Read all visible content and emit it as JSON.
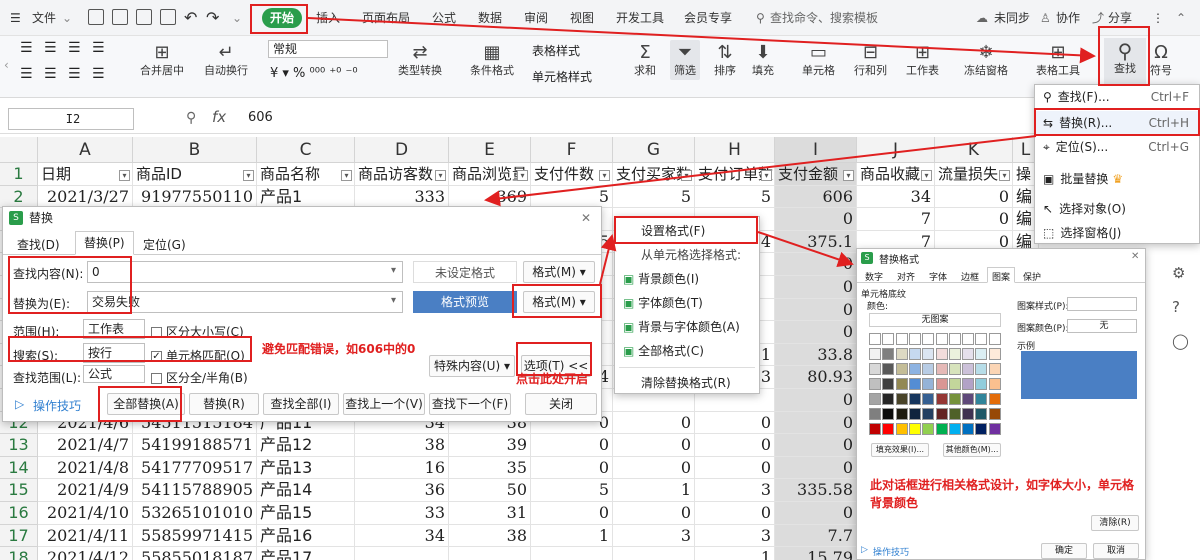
{
  "menubar": {
    "file": "文件",
    "tabs": [
      "开始",
      "插入",
      "页面布局",
      "公式",
      "数据",
      "审阅",
      "视图",
      "开发工具",
      "会员专享"
    ],
    "search": "查找命令、搜索模板",
    "sync": "未同步",
    "collab": "协作",
    "share": "分享"
  },
  "ribbon": {
    "merge": "合并居中",
    "wrap": "自动换行",
    "format_regular": "常规",
    "convert": "类型转换",
    "cond_format": "条件格式",
    "table_style": "表格样式",
    "cell_style": "单元格样式",
    "sum": "求和",
    "filter": "筛选",
    "sort": "排序",
    "fill": "填充",
    "cell": "单元格",
    "rowcol": "行和列",
    "sheet": "工作表",
    "freeze": "冻结窗格",
    "table_tools": "表格工具",
    "find": "查找",
    "symbol": "符号"
  },
  "formula": {
    "cell_ref": "I2",
    "fx": "fx",
    "value": "606"
  },
  "find_menu": {
    "items": [
      {
        "label": "查找(F)...",
        "shortcut": "Ctrl+F"
      },
      {
        "label": "替换(R)...",
        "shortcut": "Ctrl+H"
      },
      {
        "label": "定位(S)...",
        "shortcut": "Ctrl+G"
      },
      {
        "label": "批量替换",
        "shortcut": ""
      },
      {
        "label": "选择对象(O)",
        "shortcut": ""
      },
      {
        "label": "选择窗格(J)",
        "shortcut": ""
      }
    ]
  },
  "sheet": {
    "columns": [
      "A",
      "B",
      "C",
      "D",
      "E",
      "F",
      "G",
      "H",
      "I",
      "J",
      "K",
      "L"
    ],
    "headers": [
      "日期",
      "商品ID",
      "商品名称",
      "商品访客数",
      "商品浏览量",
      "支付件数",
      "支付买家数",
      "支付订单数",
      "支付金额",
      "商品收藏",
      "流量损失",
      "操"
    ],
    "rows": [
      {
        "n": "2",
        "cells": [
          "2021/3/27",
          "91977550110",
          "产品1",
          "333",
          "369",
          "5",
          "5",
          "5",
          "606",
          "34",
          "0",
          "编"
        ]
      },
      {
        "n": "3",
        "cells": [
          "",
          "",
          "",
          "",
          "",
          "",
          "",
          "",
          "0",
          "7",
          "0",
          "编"
        ]
      },
      {
        "n": "4",
        "cells": [
          "",
          "",
          "",
          "",
          "",
          "5",
          "",
          "4",
          "375.1",
          "7",
          "0",
          "编"
        ]
      },
      {
        "n": "5",
        "cells": [
          "",
          "",
          "",
          "",
          "",
          "",
          "",
          "",
          "0",
          "",
          "",
          ""
        ]
      },
      {
        "n": "6",
        "cells": [
          "",
          "",
          "",
          "",
          "",
          "",
          "",
          "",
          "0",
          "",
          "",
          ""
        ]
      },
      {
        "n": "7",
        "cells": [
          "",
          "",
          "",
          "",
          "",
          "",
          "",
          "",
          "0",
          "",
          "",
          ""
        ]
      },
      {
        "n": "8",
        "cells": [
          "",
          "",
          "",
          "",
          "",
          "",
          "",
          "",
          "0",
          "",
          "",
          ""
        ]
      },
      {
        "n": "9",
        "cells": [
          "",
          "",
          "",
          "",
          "",
          "",
          "",
          "1",
          "33.8",
          "",
          "",
          ""
        ]
      },
      {
        "n": "10",
        "cells": [
          "",
          "",
          "",
          "",
          "",
          "4",
          "1",
          "3",
          "80.93",
          "",
          "",
          ""
        ]
      },
      {
        "n": "11",
        "cells": [
          "",
          "",
          "",
          "",
          "",
          "",
          "",
          "",
          "0",
          "",
          "",
          ""
        ]
      },
      {
        "n": "12",
        "cells": [
          "2021/4/6",
          "54511515184",
          "产品11",
          "34",
          "38",
          "0",
          "0",
          "0",
          "0",
          "",
          "",
          ""
        ]
      },
      {
        "n": "13",
        "cells": [
          "2021/4/7",
          "54199188571",
          "产品12",
          "38",
          "39",
          "0",
          "0",
          "0",
          "0",
          "",
          "",
          ""
        ]
      },
      {
        "n": "14",
        "cells": [
          "2021/4/8",
          "54177709517",
          "产品13",
          "16",
          "35",
          "0",
          "0",
          "0",
          "0",
          "",
          "",
          ""
        ]
      },
      {
        "n": "15",
        "cells": [
          "2021/4/9",
          "54115788905",
          "产品14",
          "36",
          "50",
          "5",
          "1",
          "3",
          "335.58",
          "",
          "",
          ""
        ]
      },
      {
        "n": "16",
        "cells": [
          "2021/4/10",
          "53265101010",
          "产品15",
          "33",
          "31",
          "0",
          "0",
          "0",
          "0",
          "",
          "",
          ""
        ]
      },
      {
        "n": "17",
        "cells": [
          "2021/4/11",
          "55859971415",
          "产品16",
          "34",
          "38",
          "1",
          "3",
          "3",
          "7.7",
          "",
          "",
          ""
        ]
      },
      {
        "n": "18",
        "cells": [
          "2021/4/12",
          "55855018187",
          "产品17",
          "",
          "",
          "",
          "",
          "1",
          "15.79",
          "",
          "",
          ""
        ]
      }
    ]
  },
  "replace_dialog": {
    "title": "替换",
    "tabs": [
      "查找(D)",
      "替换(P)",
      "定位(G)"
    ],
    "find_label": "查找内容(N):",
    "find_value": "0",
    "replace_label": "替换为(E):",
    "replace_value": "交易失败",
    "no_format": "未设定格式",
    "format_btn": "格式(M)",
    "preview": "格式预览",
    "scope_label": "范围(H):",
    "scope_value": "工作表",
    "case": "区分大小写(C)",
    "search_label": "搜索(S):",
    "search_value": "按行",
    "cell_match": "单元格匹配(O)",
    "range_label": "查找范围(L):",
    "range_value": "公式",
    "width": "区分全/半角(B)",
    "special": "特殊内容(U)",
    "options": "选项(T) <<",
    "tips": "操作技巧",
    "replace_all": "全部替换(A)",
    "replace": "替换(R)",
    "find_all": "查找全部(I)",
    "find_prev": "查找上一个(V)",
    "find_next": "查找下一个(F)",
    "close": "关闭"
  },
  "format_menu": {
    "items": [
      "设置格式(F)",
      "从单元格选择格式:",
      "背景颜色(I)",
      "字体颜色(T)",
      "背景与字体颜色(A)",
      "全部格式(C)",
      "清除替换格式(R)"
    ]
  },
  "format_dialog": {
    "title": "替换格式",
    "tabs": [
      "数字",
      "对齐",
      "字体",
      "边框",
      "图案",
      "保护"
    ],
    "shading": "单元格底纹",
    "color_label": "颜色:",
    "no_color": "无图案",
    "pattern_style": "图案样式(P):",
    "pattern_color": "图案颜色(P):",
    "pattern_color_value": "无",
    "sample": "示例",
    "fill_effects": "填充效果(I)...",
    "more_colors": "其他颜色(M)...",
    "clear": "清除(R)",
    "tips": "操作技巧",
    "ok": "确定",
    "cancel": "取消",
    "sample_color": "#4a7fc4",
    "palette": [
      "#ffffff",
      "#ffffff",
      "#ffffff",
      "#ffffff",
      "#ffffff",
      "#ffffff",
      "#ffffff",
      "#ffffff",
      "#ffffff",
      "#ffffff",
      "#f2f2f2",
      "#7f7f7f",
      "#ddd9c3",
      "#c6d9f0",
      "#dbe5f1",
      "#f2dcdb",
      "#ebf1dd",
      "#e5e0ec",
      "#dbeef3",
      "#fdeada",
      "#d8d8d8",
      "#595959",
      "#c4bd97",
      "#8db3e2",
      "#b8cce4",
      "#e5b9b7",
      "#d7e3bc",
      "#ccc1d9",
      "#b7dde8",
      "#fbd5b5",
      "#bfbfbf",
      "#3f3f3f",
      "#938953",
      "#548dd4",
      "#95b3d7",
      "#d99694",
      "#c3d69b",
      "#b2a2c7",
      "#92cddc",
      "#fac08f",
      "#a5a5a5",
      "#262626",
      "#494429",
      "#17365d",
      "#366092",
      "#953734",
      "#76923c",
      "#5f497a",
      "#31859b",
      "#e36c09",
      "#7f7f7f",
      "#0c0c0c",
      "#1d1b10",
      "#0f243e",
      "#244061",
      "#632423",
      "#4f6128",
      "#3f3151",
      "#205867",
      "#974806",
      "#c00000",
      "#ff0000",
      "#ffc000",
      "#ffff00",
      "#92d050",
      "#00b050",
      "#00b0f0",
      "#0070c0",
      "#002060",
      "#7030a0"
    ]
  },
  "annotations": {
    "avoid": "避免匹配错误，如606中的0",
    "click_here": "点击此处开启",
    "format_note": "此对话框进行相关格式设计，如字体大小，单元格背景颜色",
    "accent": "#e02020"
  }
}
